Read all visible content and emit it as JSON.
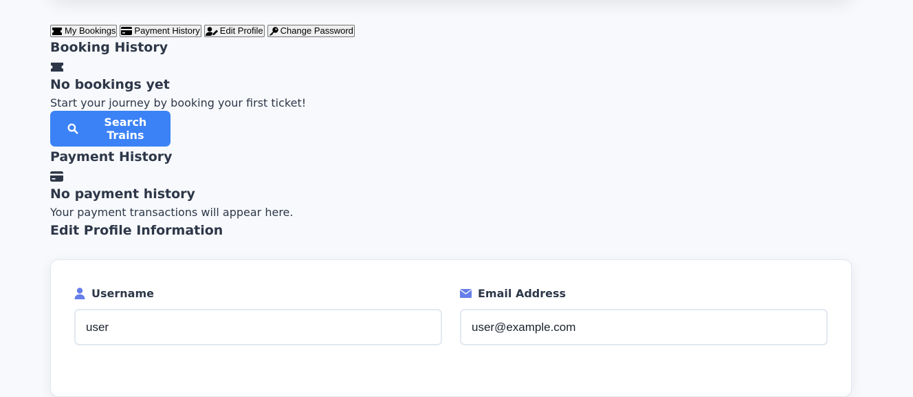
{
  "tabs": [
    {
      "label": "My Bookings",
      "icon": "ticket-icon"
    },
    {
      "label": "Payment History",
      "icon": "credit-card-icon"
    },
    {
      "label": "Edit Profile",
      "icon": "user-edit-icon"
    },
    {
      "label": "Change Password",
      "icon": "key-icon"
    }
  ],
  "bookings": {
    "title": "Booking History",
    "empty_icon": "ticket-icon",
    "empty_title": "No bookings yet",
    "empty_text": "Start your journey by booking your first ticket!",
    "search_button": "Search Trains"
  },
  "payments": {
    "title": "Payment History",
    "empty_icon": "credit-card-icon",
    "empty_title": "No payment history",
    "empty_text": "Your payment transactions will appear here."
  },
  "profile": {
    "title": "Edit Profile Information",
    "username_label": "Username",
    "username_value": "user",
    "email_label": "Email Address",
    "email_value": "user@example.com"
  },
  "colors": {
    "primary": "#3b82f6",
    "icon_accent": "#667eea",
    "background": "#f7f9fc",
    "text": "#2d3748"
  }
}
